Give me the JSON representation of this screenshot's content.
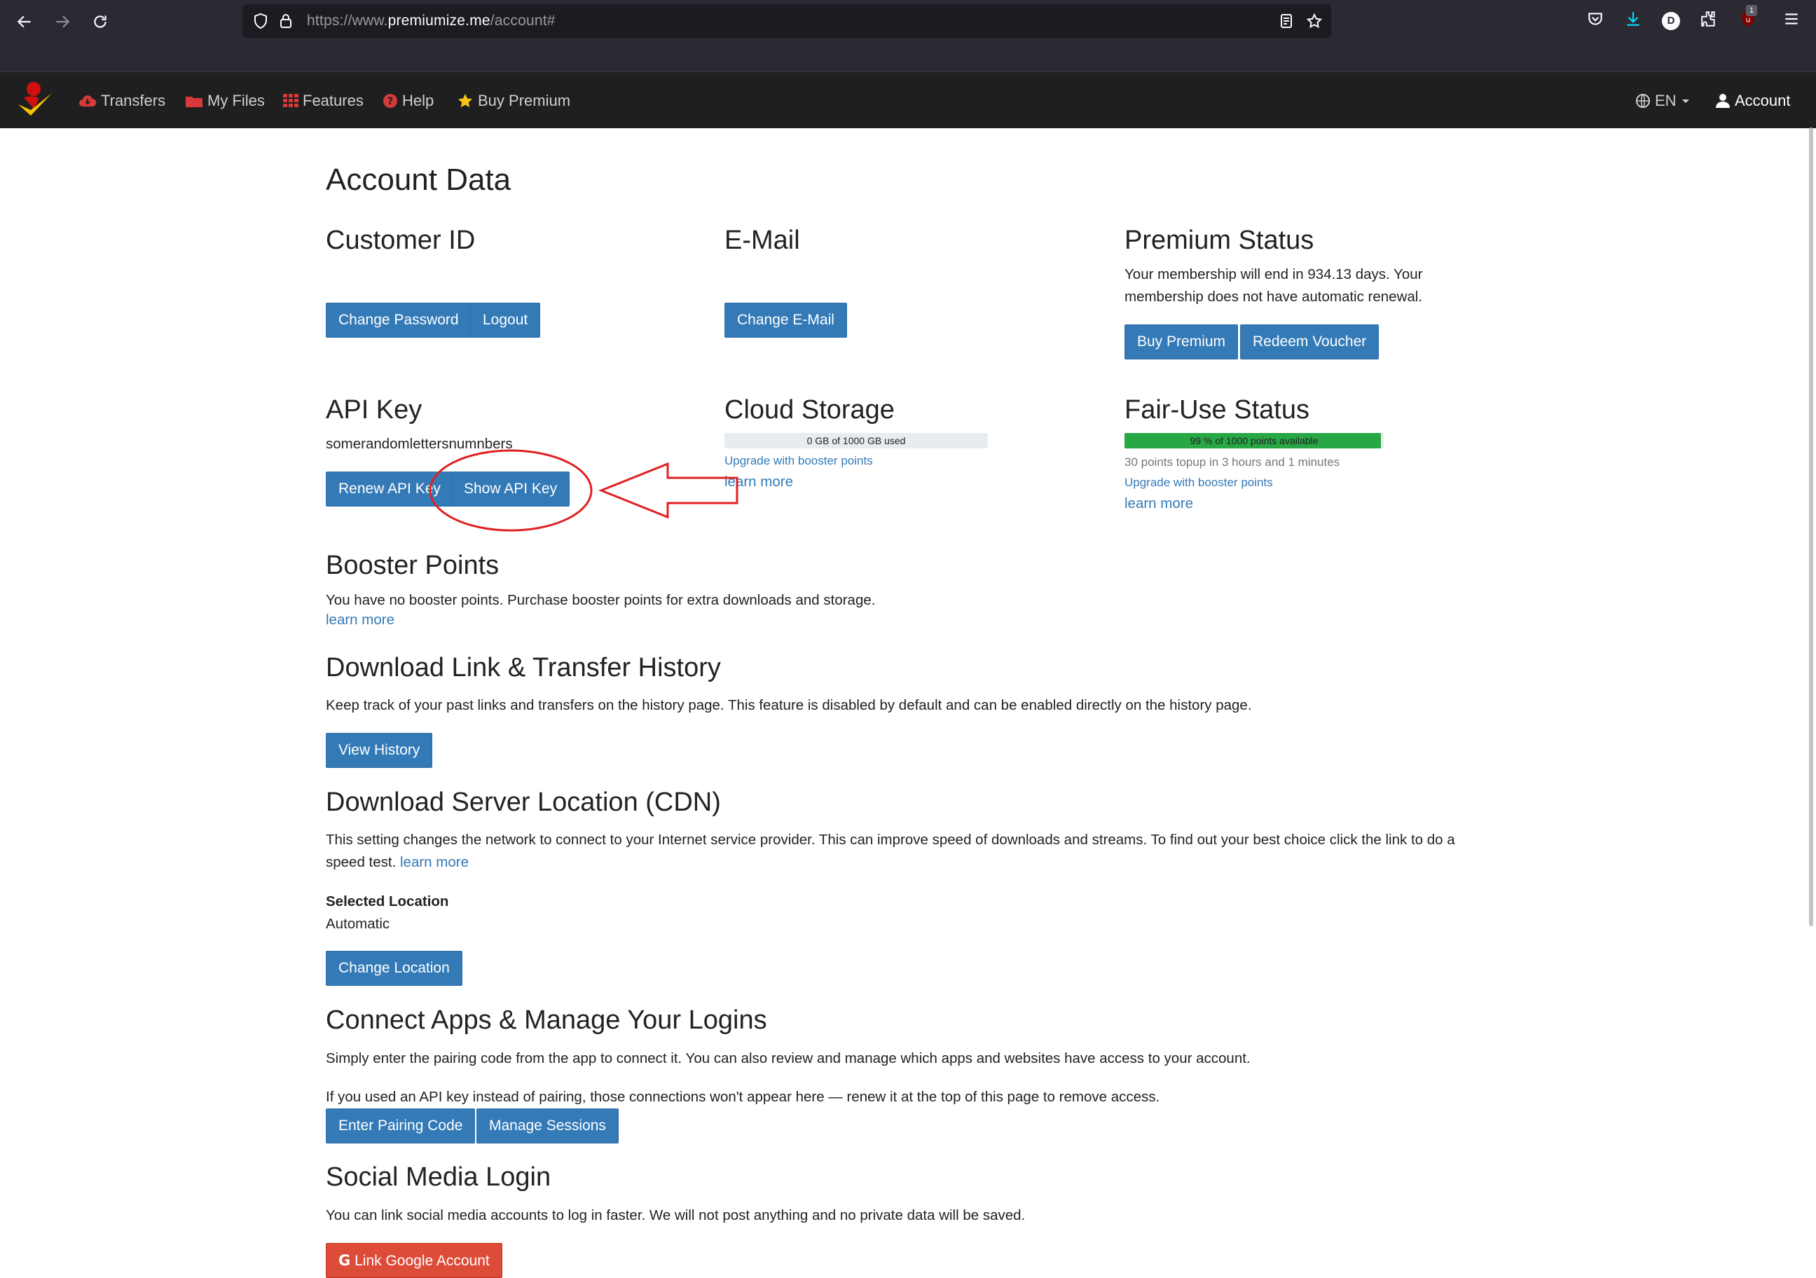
{
  "browser": {
    "url_scheme": "https://www.",
    "url_domain": "premiumize.me",
    "url_path": "/account#",
    "profile_initial": "D",
    "extension_badge": "1"
  },
  "nav": {
    "items": [
      {
        "label": "Transfers",
        "icon": "cloud-download-icon"
      },
      {
        "label": "My Files",
        "icon": "folder-icon"
      },
      {
        "label": "Features",
        "icon": "grid-icon"
      },
      {
        "label": "Help",
        "icon": "question-icon"
      },
      {
        "label": "Buy Premium",
        "icon": "star-icon"
      }
    ],
    "language": "EN",
    "account": "Account"
  },
  "page": {
    "title": "Account Data",
    "customer": {
      "heading": "Customer ID",
      "change_password": "Change Password",
      "logout": "Logout"
    },
    "email": {
      "heading": "E-Mail",
      "change_email": "Change E-Mail"
    },
    "premium": {
      "heading": "Premium Status",
      "line1": "Your membership will end in 934.13 days. Your",
      "line2": "membership does not have automatic renewal.",
      "buy_premium": "Buy Premium",
      "redeem_voucher": "Redeem Voucher"
    },
    "api": {
      "heading": "API Key",
      "key": "somerandomlettersnumnbers",
      "renew": "Renew API Key",
      "show": "Show API Key"
    },
    "storage": {
      "heading": "Cloud Storage",
      "bar_label": "0 GB of 1000 GB used",
      "used_fraction": 0,
      "upgrade": "Upgrade with booster points",
      "learn_more": "learn more"
    },
    "fairuse": {
      "heading": "Fair-Use Status",
      "bar_label": "99 % of 1000 points available",
      "available_fraction": 0.99,
      "topup": "30 points topup in 3 hours and 1 minutes",
      "upgrade": "Upgrade with booster points",
      "learn_more": "learn more",
      "bar_color": "#28a745"
    },
    "booster": {
      "heading": "Booster Points",
      "text": "You have no booster points. Purchase booster points for extra downloads and storage.",
      "learn_more": "learn more"
    },
    "history": {
      "heading": "Download Link & Transfer History",
      "text": "Keep track of your past links and transfers on the history page. This feature is disabled by default and can be enabled directly on the history page.",
      "view_history": "View History"
    },
    "cdn": {
      "heading": "Download Server Location (CDN)",
      "line1": "This setting changes the network to connect to your Internet service provider. This can improve speed of downloads and streams. To find out your best choice click the link to do a",
      "line2_prefix": "speed test.",
      "learn_more": "learn more",
      "selected_label": "Selected Location",
      "selected_value": "Automatic",
      "change_location": "Change Location"
    },
    "apps": {
      "heading": "Connect Apps & Manage Your Logins",
      "text1": "Simply enter the pairing code from the app to connect it. You can also review and manage which apps and websites have access to your account.",
      "text2": "If you used an API key instead of pairing, those connections won't appear here — renew it at the top of this page to remove access.",
      "enter_pairing": "Enter Pairing Code",
      "manage_sessions": "Manage Sessions"
    },
    "social": {
      "heading": "Social Media Login",
      "text": "You can link social media accounts to log in faster. We will not post anything and no private data will be saved.",
      "google_letter": "G",
      "link_google": "Link Google Account"
    }
  },
  "colors": {
    "primary": "#337ab7",
    "google_red": "#dd4b39",
    "navbar_bg": "#1f1f1f",
    "annotation_red": "#e02020"
  }
}
